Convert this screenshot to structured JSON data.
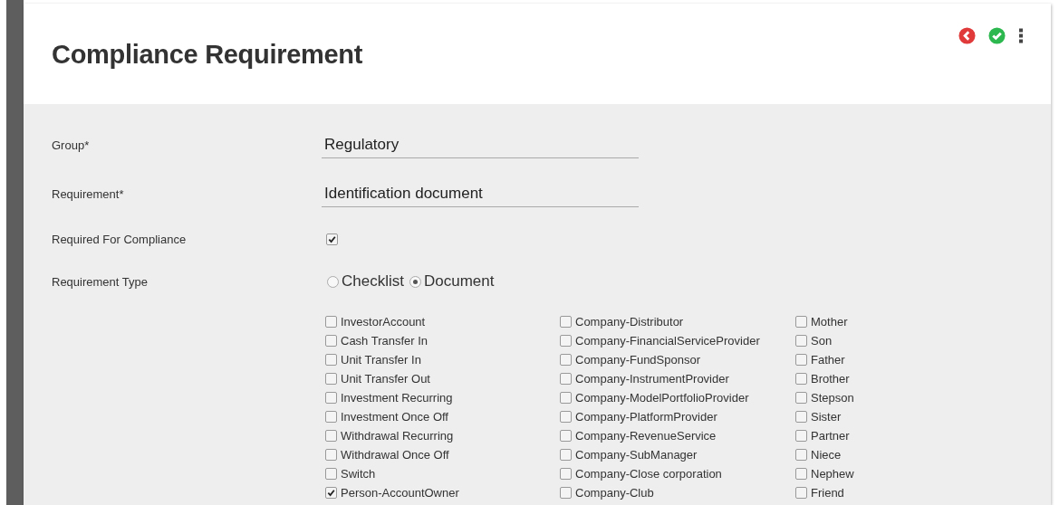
{
  "title": "Compliance Requirement",
  "fields": [
    {
      "label": "Group*",
      "value": "Regulatory"
    },
    {
      "label": "Requirement*",
      "value": "Identification document"
    }
  ],
  "required_for_compliance": {
    "label": "Required For Compliance",
    "checked": true
  },
  "requirement_type": {
    "label": "Requirement Type",
    "options": [
      {
        "label": "Checklist",
        "selected": false
      },
      {
        "label": "Document",
        "selected": true
      }
    ]
  },
  "applies_to": {
    "columns": [
      [
        {
          "label": "InvestorAccount",
          "checked": false
        },
        {
          "label": "Cash Transfer In",
          "checked": false
        },
        {
          "label": "Unit Transfer In",
          "checked": false
        },
        {
          "label": "Unit Transfer Out",
          "checked": false
        },
        {
          "label": "Investment Recurring",
          "checked": false
        },
        {
          "label": "Investment Once Off",
          "checked": false
        },
        {
          "label": "Withdrawal Recurring",
          "checked": false
        },
        {
          "label": "Withdrawal Once Off",
          "checked": false
        },
        {
          "label": "Switch",
          "checked": false
        },
        {
          "label": "Person-AccountOwner",
          "checked": true
        }
      ],
      [
        {
          "label": "Company-Distributor",
          "checked": false
        },
        {
          "label": "Company-FinancialServiceProvider",
          "checked": false
        },
        {
          "label": "Company-FundSponsor",
          "checked": false
        },
        {
          "label": "Company-InstrumentProvider",
          "checked": false
        },
        {
          "label": "Company-ModelPortfolioProvider",
          "checked": false
        },
        {
          "label": "Company-PlatformProvider",
          "checked": false
        },
        {
          "label": "Company-RevenueService",
          "checked": false
        },
        {
          "label": "Company-SubManager",
          "checked": false
        },
        {
          "label": "Company-Close corporation",
          "checked": false
        },
        {
          "label": "Company-Club",
          "checked": false
        }
      ],
      [
        {
          "label": "Mother",
          "checked": false
        },
        {
          "label": "Son",
          "checked": false
        },
        {
          "label": "Father",
          "checked": false
        },
        {
          "label": "Brother",
          "checked": false
        },
        {
          "label": "Stepson",
          "checked": false
        },
        {
          "label": "Sister",
          "checked": false
        },
        {
          "label": "Partner",
          "checked": false
        },
        {
          "label": "Niece",
          "checked": false
        },
        {
          "label": "Nephew",
          "checked": false
        },
        {
          "label": "Friend",
          "checked": false
        }
      ]
    ]
  }
}
